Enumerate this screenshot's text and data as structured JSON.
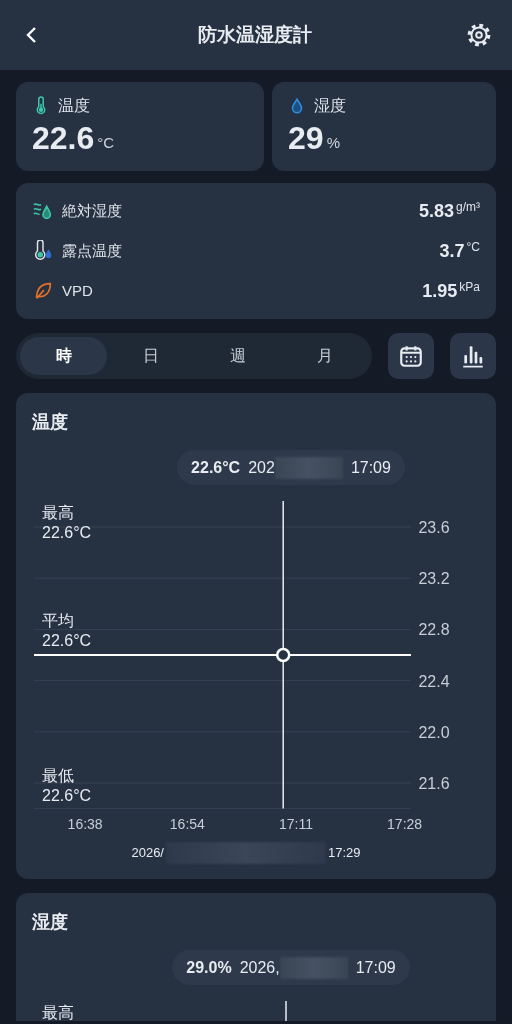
{
  "header": {
    "title": "防水温湿度計"
  },
  "readings": [
    {
      "kind": "temperature",
      "label": "温度",
      "value": "22.6",
      "unit": "°C"
    },
    {
      "kind": "humidity",
      "label": "湿度",
      "value": "29",
      "unit": "%"
    }
  ],
  "details": [
    {
      "kind": "absolute_humidity",
      "label": "絶対湿度",
      "value": "5.83",
      "unit": "g/m³"
    },
    {
      "kind": "dew_point",
      "label": "露点温度",
      "value": "3.7",
      "unit": "°C"
    },
    {
      "kind": "vpd",
      "label": "VPD",
      "value": "1.95",
      "unit": "kPa"
    }
  ],
  "period_tabs": [
    {
      "label": "時",
      "selected": true
    },
    {
      "label": "日",
      "selected": false
    },
    {
      "label": "週",
      "selected": false
    },
    {
      "label": "月",
      "selected": false
    }
  ],
  "charts": [
    {
      "tooltip": {
        "value": "22.6°C",
        "date": "202",
        "time": "17:09"
      },
      "stats": [
        {
          "label": "最高",
          "value": "22.6°C"
        },
        {
          "label": "平均",
          "value": "22.6°C"
        },
        {
          "label": "最低",
          "value": "22.6°C"
        }
      ],
      "range": {
        "start": "2026/",
        "end": "17:29"
      },
      "chart_data": {
        "type": "line",
        "title": "温度",
        "x": [
          990,
          1049
        ],
        "series": [
          {
            "color": "#ffffff",
            "values": [
              22.6,
              22.6
            ]
          }
        ],
        "xlim": [
          990,
          1049
        ],
        "ylim": [
          21.4,
          23.6
        ],
        "xticks": [
          {
            "value": 998,
            "label": "16:38"
          },
          {
            "value": 1014,
            "label": "16:54"
          },
          {
            "value": 1031,
            "label": "17:11"
          },
          {
            "value": 1048,
            "label": "17:28"
          }
        ],
        "yticks": [
          {
            "value": 21.6,
            "label": "21.6"
          },
          {
            "value": 22.0,
            "label": "22.0"
          },
          {
            "value": 22.4,
            "label": "22.4"
          },
          {
            "value": 22.8,
            "label": "22.8"
          },
          {
            "value": 23.2,
            "label": "23.2"
          },
          {
            "value": 23.6,
            "label": "23.6"
          }
        ],
        "grid": true,
        "ref_lines": [
          {
            "axis": "x",
            "value": 1029
          }
        ]
      }
    },
    {
      "title": "湿度",
      "tooltip": {
        "value": "29.0%",
        "date": "2026,",
        "time": "17:09"
      },
      "stats": [
        {
          "label": "最高"
        }
      ]
    }
  ]
}
